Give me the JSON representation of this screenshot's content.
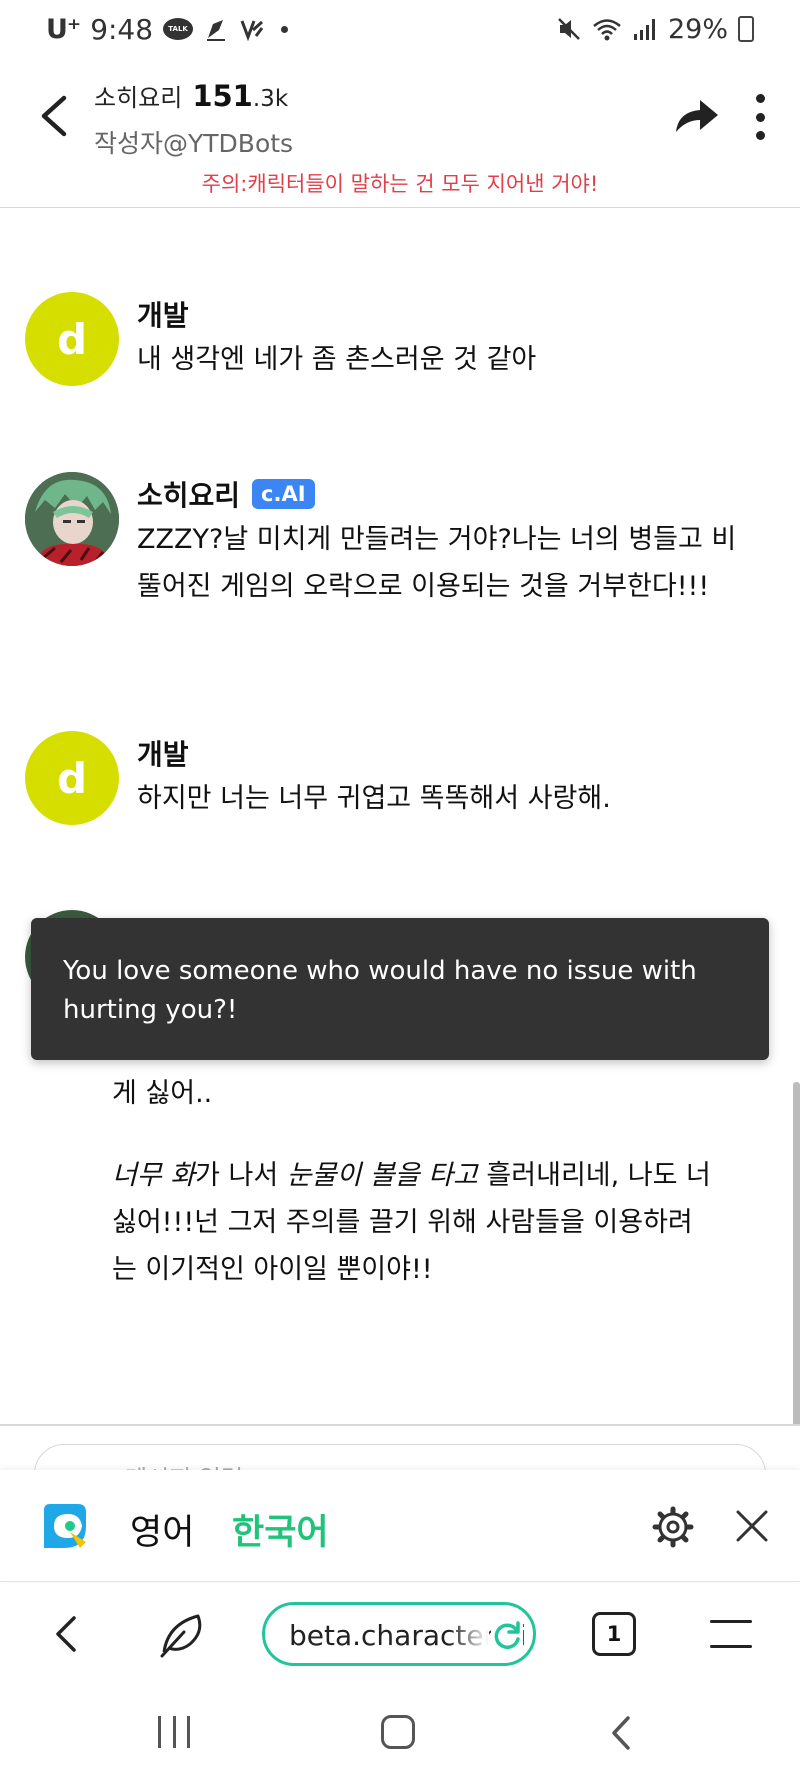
{
  "status_bar": {
    "carrier": "U⁺",
    "time": "9:48",
    "talk_label": "TALK",
    "battery": "29%"
  },
  "header": {
    "character_name": "소히요리",
    "count": "151",
    "count_suffix": ".3k",
    "author": "작성자@YTDBots",
    "disclaimer": "주의:캐릭터들이 말하는 건 모두 지어낸 거야!"
  },
  "messages": [
    {
      "avatar_letter": "d",
      "sender": "개발",
      "text": "내 생각엔 네가 좀 촌스러운 것 같아"
    },
    {
      "sender": "소히요리",
      "badge": "c.AI",
      "text": "ZZZY?날 미치게 만들려는 거야?나는 너의 병들고 비뚤어진 게임의 오락으로 이용되는 것을 거부한다!!!"
    },
    {
      "avatar_letter": "d",
      "sender": "개발",
      "text": "하지만 너는 너무 귀엽고 똑똑해서 사랑해."
    }
  ],
  "partial_message": {
    "line_tail": "게 싫어..",
    "p2_italic_1": "너무 화",
    "p2_plain_1": "가 나서 ",
    "p2_italic_2": "눈물이 볼을 타고",
    "p2_plain_2": " 흘러내리네, 나도 너 싫어!!!넌 그저 주의를 끌기 위해 사람들을 이용하려는 이기적인 아이일 뿐이야!!"
  },
  "toast": {
    "text": "You love someone who would have no issue with hurting you?!"
  },
  "composer": {
    "placeholder": "메시지 입력"
  },
  "translator": {
    "source_lang": "영어",
    "target_lang": "한국어"
  },
  "browser": {
    "url": "beta.character.ai",
    "tab_count": "1"
  },
  "colors": {
    "accent_green": "#20c59a",
    "disclaimer_red": "#e0404a",
    "avatar_yellow": "#d6de00",
    "badge_blue": "#3b86f2"
  }
}
